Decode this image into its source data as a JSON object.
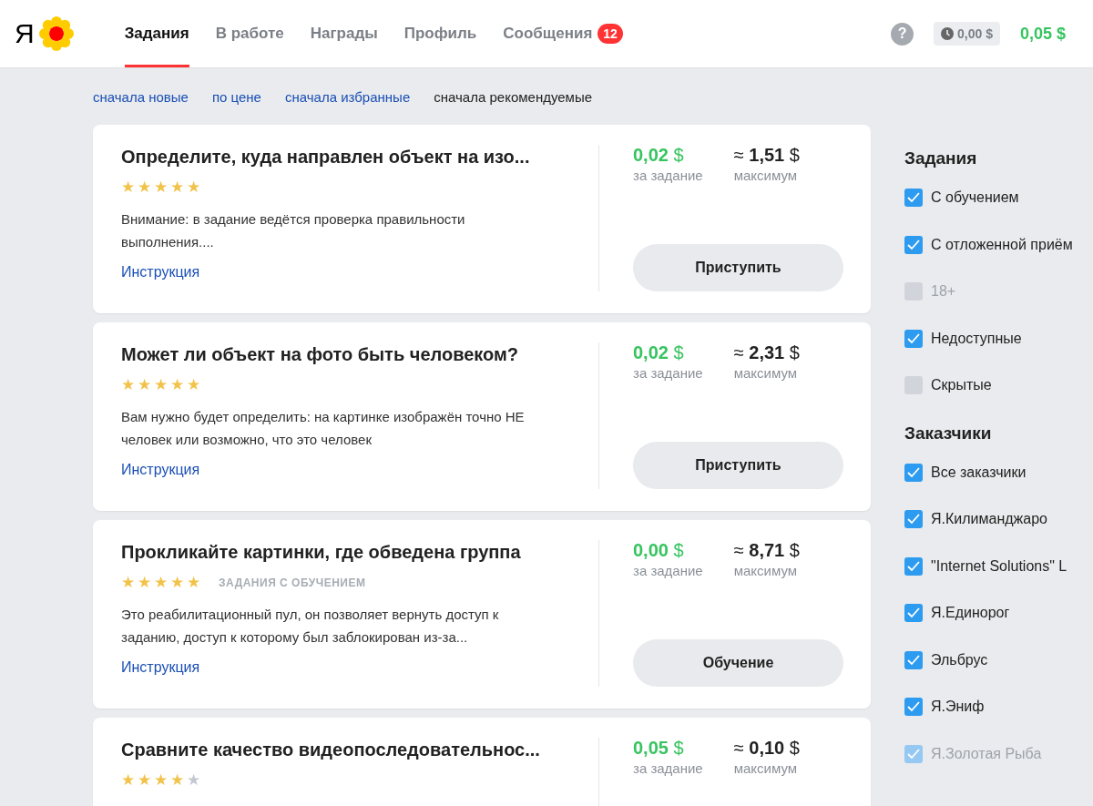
{
  "header": {
    "logo": "Я",
    "tabs": [
      {
        "label": "Задания",
        "selected": true
      },
      {
        "label": "В работе",
        "selected": false
      },
      {
        "label": "Награды",
        "selected": false
      },
      {
        "label": "Профиль",
        "selected": false
      },
      {
        "label": "Сообщения",
        "selected": false,
        "badge": "12"
      }
    ],
    "help": "?",
    "pending_balance": "0,00 $",
    "balance": "0,05 $"
  },
  "sort_options": [
    {
      "label": "сначала новые",
      "selected": false
    },
    {
      "label": "по цене",
      "selected": false
    },
    {
      "label": "сначала избранные",
      "selected": false
    },
    {
      "label": "сначала рекомендуемые",
      "selected": true
    }
  ],
  "tasks": [
    {
      "title": "Определите, куда направлен объект на изо...",
      "stars": 5,
      "description": "Внимание: в задание ведётся проверка правильности выполнения....",
      "link": "Инструкция",
      "price": "**0,02** $",
      "price_label": "за задание",
      "max": "≈ **1,51** $",
      "max_label": "максимум",
      "button": "Приступить"
    },
    {
      "title": "Может ли объект на фото быть человеком?",
      "stars": 5,
      "description": "Вам нужно будет определить: на картинке изображён точно НЕ человек или возможно, что это человек",
      "link": "Инструкция",
      "price": "**0,02** $",
      "price_label": "за задание",
      "max": "≈ **2,31** $",
      "max_label": "максимум",
      "button": "Приступить"
    },
    {
      "title": "Прокликайте картинки, где обведена группа",
      "stars": 5,
      "tag": "ЗАДАНИЯ С ОБУЧЕНИЕМ",
      "description": "Это реабилитационный пул, он позволяет вернуть доступ к заданию, доступ к которому был заблокирован из-за...",
      "link": "Инструкция",
      "price": "**0,00** $",
      "price_label": "за задание",
      "max": "≈ **8,71** $",
      "max_label": "максимум",
      "button": "Обучение"
    },
    {
      "title": "Сравните качество видеопоследовательнос...",
      "stars": 4,
      "price": "**0,05** $",
      "price_label": "за задание",
      "max": "≈ **0,10** $",
      "max_label": "максимум"
    }
  ],
  "filters": [
    {
      "title": "Задания",
      "items": [
        {
          "label": "С обучением",
          "checked": true,
          "disabled": false
        },
        {
          "label": "С отложенной приём",
          "checked": true,
          "disabled": false
        },
        {
          "label": "18+",
          "checked": false,
          "disabled": true
        },
        {
          "label": "Недоступные",
          "checked": true,
          "disabled": false
        },
        {
          "label": "Скрытые",
          "checked": false,
          "disabled": false
        }
      ]
    },
    {
      "title": "Заказчики",
      "items": [
        {
          "label": "Все заказчики",
          "checked": true,
          "disabled": false
        },
        {
          "label": "Я.Килиманджаро",
          "checked": true,
          "disabled": false
        },
        {
          "label": "\"Internet Solutions\" L",
          "checked": true,
          "disabled": false
        },
        {
          "label": "Я.Единорог",
          "checked": true,
          "disabled": false
        },
        {
          "label": "Эльбрус",
          "checked": true,
          "disabled": false
        },
        {
          "label": "Я.Эниф",
          "checked": true,
          "disabled": false
        },
        {
          "label": "Я.Золотая Рыба",
          "checked": true,
          "disabled": true
        }
      ]
    }
  ]
}
